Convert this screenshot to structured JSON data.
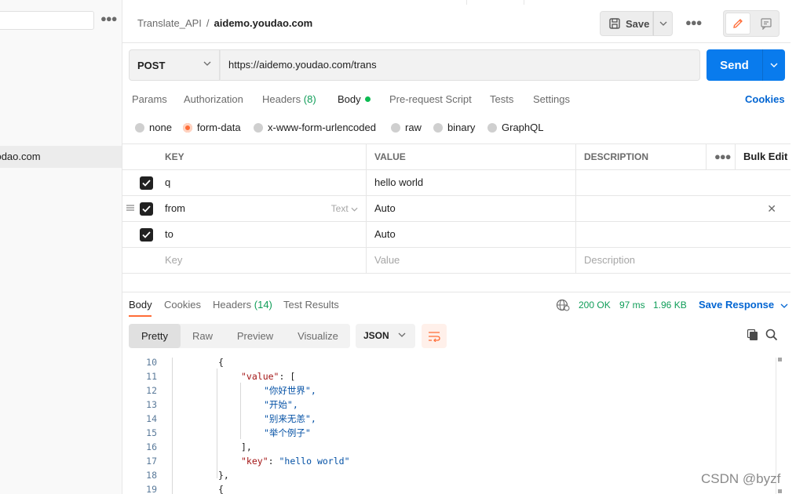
{
  "sidebar": {
    "selected_item": "daodao.com"
  },
  "header": {
    "breadcrumb_parent": "Translate_API",
    "breadcrumb_separator": "/",
    "breadcrumb_current": "aidemo.youdao.com",
    "save_label": "Save"
  },
  "request": {
    "method": "POST",
    "url": "https://aidemo.youdao.com/trans",
    "send_label": "Send",
    "tabs": [
      {
        "label": "Params"
      },
      {
        "label": "Authorization"
      },
      {
        "label": "Headers",
        "count": "(8)"
      },
      {
        "label": "Body"
      },
      {
        "label": "Pre-request Script"
      },
      {
        "label": "Tests"
      },
      {
        "label": "Settings"
      }
    ],
    "active_tab": "Body",
    "cookies_label": "Cookies",
    "body_types": [
      "none",
      "form-data",
      "x-www-form-urlencoded",
      "raw",
      "binary",
      "GraphQL"
    ],
    "selected_body_type": "form-data"
  },
  "params_table": {
    "headers": {
      "key": "KEY",
      "value": "VALUE",
      "description": "DESCRIPTION",
      "bulk_edit": "Bulk Edit"
    },
    "rows": [
      {
        "checked": true,
        "key": "q",
        "value": "hello world",
        "description": ""
      },
      {
        "checked": true,
        "key": "from",
        "type": "Text",
        "value": "Auto",
        "description": ""
      },
      {
        "checked": true,
        "key": "to",
        "value": "Auto",
        "description": ""
      }
    ],
    "placeholders": {
      "key": "Key",
      "value": "Value",
      "description": "Description"
    }
  },
  "response": {
    "tabs": [
      {
        "label": "Body"
      },
      {
        "label": "Cookies"
      },
      {
        "label": "Headers",
        "count": "(14)"
      },
      {
        "label": "Test Results"
      }
    ],
    "active_tab": "Body",
    "status": "200 OK",
    "time": "97 ms",
    "size": "1.96 KB",
    "save_response_label": "Save Response",
    "views": [
      "Pretty",
      "Raw",
      "Preview",
      "Visualize"
    ],
    "active_view": "Pretty",
    "format": "JSON"
  },
  "code_lines": [
    {
      "n": "10",
      "text": "{"
    },
    {
      "n": "11",
      "text": "\"value\": ["
    },
    {
      "n": "12",
      "text": "\"你好世界\","
    },
    {
      "n": "13",
      "text": "\"开始\","
    },
    {
      "n": "14",
      "text": "\"别来无恙\","
    },
    {
      "n": "15",
      "text": "\"举个例子\""
    },
    {
      "n": "16",
      "text": "],"
    },
    {
      "n": "17",
      "text": "\"key\": \"hello world\""
    },
    {
      "n": "18",
      "text": "},"
    },
    {
      "n": "19",
      "text": "{"
    }
  ],
  "watermark": "CSDN @byzf",
  "colors": {
    "accent": "#ff6c37",
    "send": "#097bed",
    "link": "#0265d2",
    "status_ok": "#0f9d58"
  }
}
